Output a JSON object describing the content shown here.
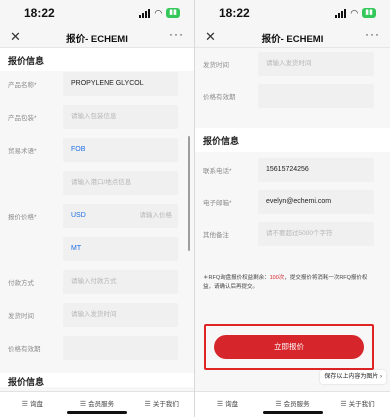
{
  "status": {
    "time": "18:22"
  },
  "nav": {
    "title": "报价- ECHEMI",
    "close_glyph": "✕",
    "more_glyph": "···"
  },
  "left": {
    "section_title": "报价信息",
    "fields": {
      "product_name": {
        "label": "产品名称*",
        "value": "PROPYLENE GLYCOL"
      },
      "packaging": {
        "label": "产品包装*",
        "placeholder": "请输入包装信息"
      },
      "trade_terms": {
        "label": "贸易术语*",
        "value": "FOB"
      },
      "port": {
        "placeholder": "请输入港口/地点信息"
      },
      "price": {
        "label": "报价价格*",
        "currency": "USD",
        "placeholder": "请输入价格"
      },
      "unit": {
        "value": "MT"
      },
      "payment": {
        "label": "付款方式",
        "placeholder": "请输入付款方式"
      },
      "ship_time": {
        "label": "发货时间",
        "placeholder": "请输入发货时间"
      },
      "validity": {
        "label": "价格有效期"
      }
    },
    "next_section_partial": "报价信息"
  },
  "right": {
    "fields": {
      "ship_time": {
        "label": "发货时间",
        "placeholder": "请输入发货时间"
      },
      "validity": {
        "label": "价格有效期"
      }
    },
    "section_title": "报价信息",
    "contact": {
      "phone": {
        "label": "联系电话*",
        "value": "15615724256"
      },
      "email": {
        "label": "电子邮箱*",
        "value": "evelyn@echemi.com"
      },
      "remark": {
        "label": "其他备注",
        "placeholder": "请不要超过5000个字符"
      }
    },
    "note": {
      "prefix": "＊RFQ询盘报价权益剩余：",
      "count": "100次",
      "suffix": "，提交报价将消耗一次RFQ报价权益，请确认后再提交。"
    },
    "submit_label": "立即报价",
    "save_bubble": "保存以上内容为图片 ›"
  },
  "tabbar": [
    {
      "label": "询盘",
      "icon": "menu-icon"
    },
    {
      "label": "会员服务",
      "icon": "menu-icon"
    },
    {
      "label": "关于我们",
      "icon": "menu-icon"
    }
  ],
  "colors": {
    "accent_red": "#d6262c",
    "link_blue": "#1f6fe5",
    "highlight_border": "#e02424"
  }
}
